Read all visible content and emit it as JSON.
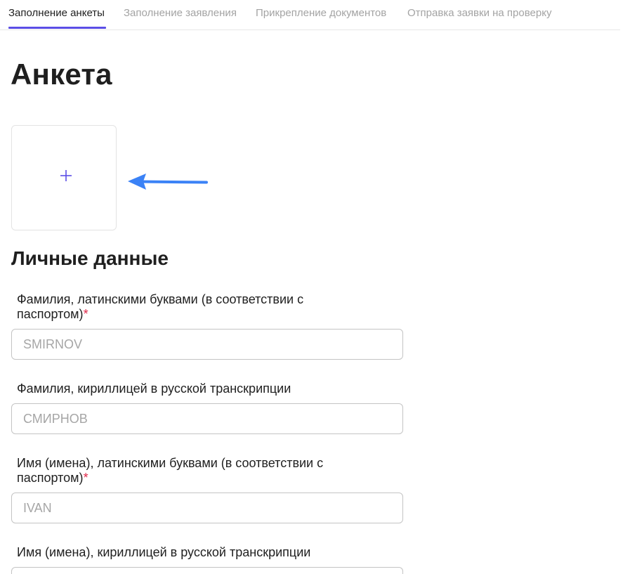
{
  "tabs": [
    {
      "label": "Заполнение анкеты",
      "active": true
    },
    {
      "label": "Заполнение заявления",
      "active": false
    },
    {
      "label": "Прикрепление документов",
      "active": false
    },
    {
      "label": "Отправка заявки на проверку",
      "active": false
    }
  ],
  "page": {
    "title": "Анкета"
  },
  "photo_upload": {
    "icon": "plus-icon",
    "annotation_icon": "arrow-left-icon"
  },
  "personal": {
    "title": "Личные данные",
    "fields": [
      {
        "label": "Фамилия, латинскими буквами (в соответствии с паспортом)",
        "required_mark": "*",
        "placeholder": "SMIRNOV"
      },
      {
        "label": "Фамилия, кириллицей в русской транскрипции",
        "required_mark": "",
        "placeholder": "СМИРНОВ"
      },
      {
        "label": "Имя (имена), латинскими буквами (в соответствии с паспортом)",
        "required_mark": "*",
        "placeholder": "IVAN"
      },
      {
        "label": "Имя (имена), кириллицей в русской транскрипции",
        "required_mark": "",
        "placeholder": ""
      }
    ]
  },
  "colors": {
    "accent": "#5b4ee6",
    "required": "#e0294a",
    "annotation_arrow": "#3b82f6"
  }
}
